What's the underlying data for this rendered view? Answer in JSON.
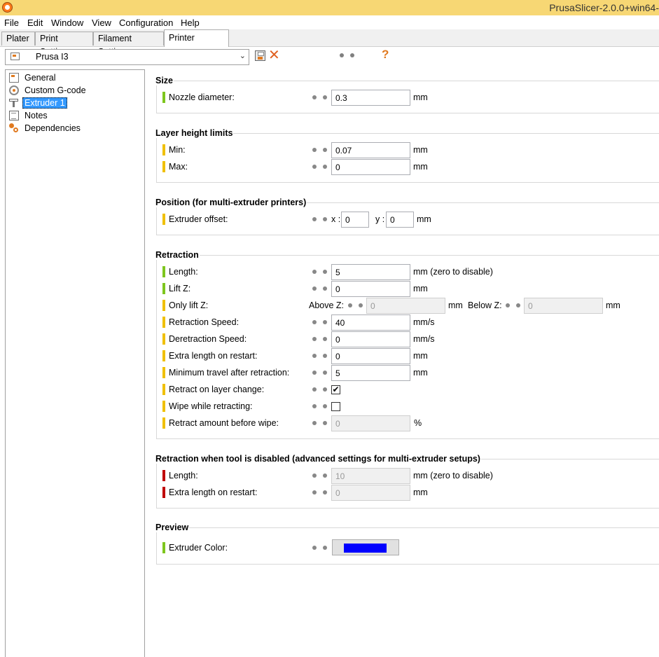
{
  "window": {
    "title": "PrusaSlicer-2.0.0+win64-"
  },
  "menu": [
    "File",
    "Edit",
    "Window",
    "View",
    "Configuration",
    "Help"
  ],
  "tabs": [
    "Plater",
    "Print Settings",
    "Filament Settings",
    "Printer Settings"
  ],
  "active_tab": "Printer Settings",
  "preset": {
    "name": "Prusa I3",
    "dropdown_arrow": "⌄"
  },
  "toolbar": {
    "delete_glyph": "✕",
    "help_glyph": "?"
  },
  "tree": [
    {
      "label": "General",
      "icon": "general-icon"
    },
    {
      "label": "Custom G-code",
      "icon": "gcode-icon"
    },
    {
      "label": "Extruder 1",
      "icon": "extruder-icon",
      "selected": true
    },
    {
      "label": "Notes",
      "icon": "notes-icon"
    },
    {
      "label": "Dependencies",
      "icon": "dependencies-icon"
    }
  ],
  "colors": {
    "simple": "#7ec61e",
    "advanced": "#f0c000",
    "expert": "#c00000",
    "extruder_color": "#0000ff"
  },
  "groups": {
    "size": {
      "title": "Size",
      "nozzle_diameter": {
        "label": "Nozzle diameter:",
        "value": "0.3",
        "unit": "mm"
      }
    },
    "layer_height": {
      "title": "Layer height limits",
      "min": {
        "label": "Min:",
        "value": "0.07",
        "unit": "mm"
      },
      "max": {
        "label": "Max:",
        "value": "0",
        "unit": "mm"
      }
    },
    "position": {
      "title": "Position (for multi-extruder printers)",
      "extruder_offset": {
        "label": "Extruder offset:",
        "x_label": "x :",
        "x": "0",
        "y_label": "y :",
        "y": "0",
        "unit": "mm"
      }
    },
    "retraction": {
      "title": "Retraction",
      "length": {
        "label": "Length:",
        "value": "5",
        "unit": "mm (zero to disable)"
      },
      "lift_z": {
        "label": "Lift Z:",
        "value": "0",
        "unit": "mm"
      },
      "only_lift_z": {
        "label": "Only lift Z:",
        "above_label": "Above Z:",
        "above": "0",
        "above_unit": "mm",
        "below_label": "Below Z:",
        "below": "0",
        "below_unit": "mm"
      },
      "retraction_speed": {
        "label": "Retraction Speed:",
        "value": "40",
        "unit": "mm/s"
      },
      "deretraction_speed": {
        "label": "Deretraction Speed:",
        "value": "0",
        "unit": "mm/s"
      },
      "extra_length": {
        "label": "Extra length on restart:",
        "value": "0",
        "unit": "mm"
      },
      "min_travel": {
        "label": "Minimum travel after retraction:",
        "value": "5",
        "unit": "mm"
      },
      "retract_layer_change": {
        "label": "Retract on layer change:",
        "checked": true,
        "check_glyph": "✔"
      },
      "wipe": {
        "label": "Wipe while retracting:",
        "checked": false
      },
      "retract_before_wipe": {
        "label": "Retract amount before wipe:",
        "value": "0",
        "unit": "%"
      }
    },
    "retraction_disabled": {
      "title": "Retraction when tool is disabled (advanced settings for multi-extruder setups)",
      "length": {
        "label": "Length:",
        "value": "10",
        "unit": "mm (zero to disable)"
      },
      "extra_length": {
        "label": "Extra length on restart:",
        "value": "0",
        "unit": "mm"
      }
    },
    "preview": {
      "title": "Preview",
      "extruder_color": {
        "label": "Extruder Color:"
      }
    }
  }
}
